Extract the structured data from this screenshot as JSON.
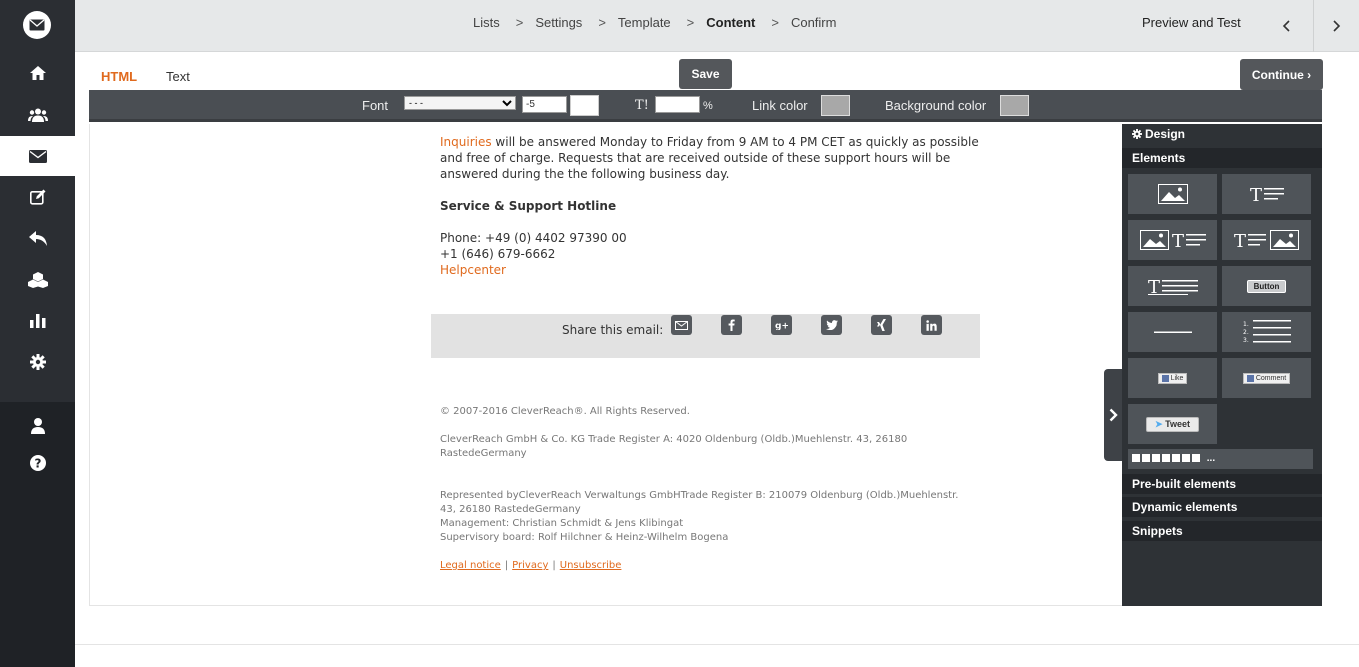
{
  "breadcrumb": {
    "items": [
      "Lists",
      "Settings",
      "Template",
      "Content",
      "Confirm"
    ],
    "active_index": 3,
    "separator": ">"
  },
  "header": {
    "preview_label": "Preview and Test",
    "prev_icon": "chevron-left-icon",
    "next_icon": "chevron-right-icon"
  },
  "tabs": [
    {
      "label": "HTML",
      "active": true
    },
    {
      "label": "Text",
      "active": false
    }
  ],
  "buttons": {
    "save": "Save",
    "continue": "Continue ›"
  },
  "format_bar": {
    "font_label": "Font",
    "font_value": "- - -",
    "size_value": "-5",
    "text_size_glyph": "T!",
    "percent_label": "%",
    "link_color_label": "Link color",
    "background_color_label": "Background color"
  },
  "email": {
    "intro_link": "Inquiries",
    "intro_text": " will be answered Monday to Friday from 9 AM to 4 PM CET as quickly as possible and free of charge. Requests that are received outside of these support hours will be answered during the the following business day.",
    "hotline_title": "Service & Support Hotline",
    "phone1": "Phone: +49 (0) 4402 97390 00",
    "phone2": "+1 (646) 679-6662",
    "helpcenter_link": "Helpcenter",
    "share_label": "Share this email:",
    "share_icons": [
      "email-icon",
      "facebook-icon",
      "google-plus-icon",
      "twitter-icon",
      "xing-icon",
      "linkedin-icon"
    ],
    "footer": {
      "copyright": "© 2007-2016 CleverReach®. All Rights Reserved.",
      "company": "CleverReach GmbH & Co. KG Trade Register A: 4020 Oldenburg (Oldb.)Muehlenstr. 43, 26180 RastedeGermany",
      "represented": "Represented byCleverReach Verwaltungs GmbHTrade Register B: 210079 Oldenburg (Oldb.)Muehlenstr. 43, 26180 RastedeGermany",
      "management": "Management: Christian Schmidt & Jens Klibingat",
      "supervisory": "Supervisory board: Rolf Hilchner & Heinz-Wilhelm Bogena",
      "legal_links": [
        "Legal notice",
        "Privacy",
        "Unsubscribe"
      ],
      "legal_sep": "|"
    }
  },
  "panel": {
    "design_label": "Design",
    "elements_label": "Elements",
    "button_tile_label": "Button",
    "like_label": "Like",
    "comment_label": "Comment",
    "tweet_label": "Tweet",
    "more_label": "...",
    "prebuilt_label": "Pre-built elements",
    "dynamic_label": "Dynamic elements",
    "snippets_label": "Snippets"
  },
  "left_nav": {
    "items": [
      "home-icon",
      "users-icon",
      "mail-icon",
      "edit-icon",
      "reply-icon",
      "cubes-icon",
      "chart-icon",
      "gear-icon",
      "user-icon",
      "help-icon"
    ],
    "active": "mail-icon"
  },
  "colors": {
    "accent": "#e06a1e",
    "nav_bg": "#2b2e33",
    "panel_bg": "#2e3236",
    "toolbar_bg": "#4a4e53"
  }
}
